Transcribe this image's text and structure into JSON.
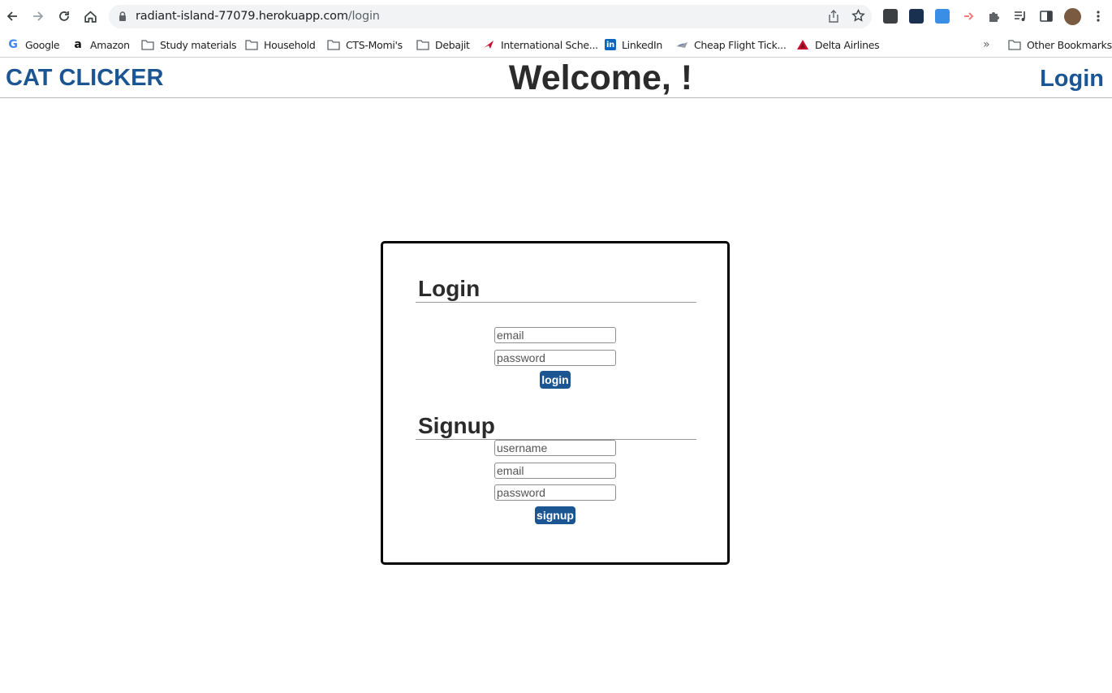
{
  "browser": {
    "url_host": "radiant-island-77079.herokuapp.com",
    "url_path": "/login",
    "bookmarks": [
      {
        "label": "Google",
        "icon": "google-icon"
      },
      {
        "label": "Amazon",
        "icon": "amazon-icon"
      },
      {
        "label": "Study materials",
        "icon": "folder-icon"
      },
      {
        "label": "Household",
        "icon": "folder-icon"
      },
      {
        "label": "CTS-Momi's",
        "icon": "folder-icon"
      },
      {
        "label": "Debajit",
        "icon": "folder-icon"
      },
      {
        "label": "International Sche...",
        "icon": "airline-icon"
      },
      {
        "label": "LinkedIn",
        "icon": "linkedin-icon"
      },
      {
        "label": "Cheap Flight Tick...",
        "icon": "plane-icon"
      },
      {
        "label": "Delta Airlines",
        "icon": "delta-icon"
      }
    ],
    "overflow_label": "»",
    "other_bookmarks": "Other Bookmarks"
  },
  "header": {
    "brand": "CAT CLICKER",
    "welcome": "Welcome, !",
    "login_link": "Login"
  },
  "login": {
    "title": "Login",
    "email_placeholder": "email",
    "password_placeholder": "password",
    "button": "login"
  },
  "signup": {
    "title": "Signup",
    "username_placeholder": "username",
    "email_placeholder": "email",
    "password_placeholder": "password",
    "button": "signup"
  },
  "colors": {
    "brand_blue": "#1b5693",
    "heading_dark": "#2b2b2b"
  }
}
